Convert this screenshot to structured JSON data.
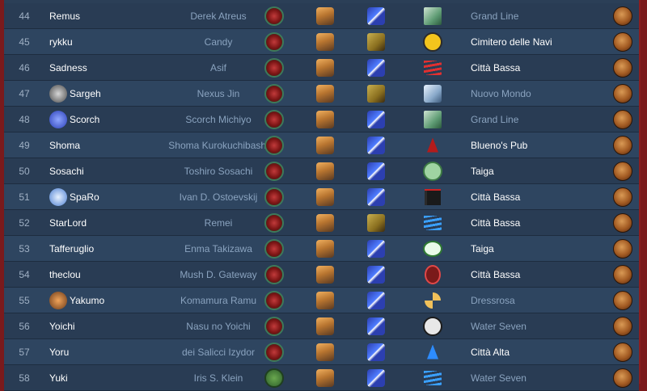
{
  "rows": [
    {
      "num": "44",
      "user": "Remus",
      "char": "Derek Atreus",
      "avatar": "",
      "icon5": "map-icon",
      "loc": "Grand Line",
      "loc_style": "blue"
    },
    {
      "num": "45",
      "user": "rykku",
      "char": "Candy",
      "avatar": "",
      "icon5": "smiley-icon",
      "loc": "Cimitero delle Navi",
      "loc_style": "white"
    },
    {
      "num": "46",
      "user": "Sadness",
      "char": "Asif",
      "avatar": "",
      "icon5": "red-wave-icon",
      "loc": "Città Bassa",
      "loc_style": "white"
    },
    {
      "num": "47",
      "user": "Sargeh",
      "char": "Nexus Jin",
      "avatar": "stone-avatar",
      "icon5": "crowd-icon",
      "loc": "Nuovo Mondo",
      "loc_style": "blue"
    },
    {
      "num": "48",
      "user": "Scorch",
      "char": "Scorch Michiyo",
      "avatar": "blue-avatar",
      "icon5": "map-icon",
      "loc": "Grand Line",
      "loc_style": "blue"
    },
    {
      "num": "49",
      "user": "Shoma",
      "char": "Shoma Kurokuchibashi",
      "avatar": "",
      "icon5": "red-drops-icon",
      "loc": "Blueno's Pub",
      "loc_style": "white"
    },
    {
      "num": "50",
      "user": "Sosachi",
      "char": "Toshiro Sosachi",
      "avatar": "",
      "icon5": "skull-green-icon",
      "loc": "Taiga",
      "loc_style": "white"
    },
    {
      "num": "51",
      "user": "SpaRo",
      "char": "Ivan D. Ostoevskij",
      "avatar": "ghost-avatar",
      "icon5": "flag-icon",
      "loc": "Città Bassa",
      "loc_style": "white"
    },
    {
      "num": "52",
      "user": "StarLord",
      "char": "Remei",
      "avatar": "",
      "icon5": "blue-wave-icon",
      "loc": "Città Bassa",
      "loc_style": "white"
    },
    {
      "num": "53",
      "user": "Tafferuglio",
      "char": "Enma Takizawa",
      "avatar": "",
      "icon5": "eye-icon",
      "loc": "Taiga",
      "loc_style": "white"
    },
    {
      "num": "54",
      "user": "theclou",
      "char": "Mush D. Gateway",
      "avatar": "",
      "icon5": "red-oval-icon",
      "loc": "Città Bassa",
      "loc_style": "white"
    },
    {
      "num": "55",
      "user": "Yakumo",
      "char": "Komamura Ramu",
      "avatar": "fox-avatar",
      "icon5": "cross-icon",
      "loc": "Dressrosa",
      "loc_style": "blue"
    },
    {
      "num": "56",
      "user": "Yoichi",
      "char": "Nasu no Yoichi",
      "avatar": "",
      "icon5": "skull-black-icon",
      "loc": "Water Seven",
      "loc_style": "blue"
    },
    {
      "num": "57",
      "user": "Yoru",
      "char": "dei Salicci Izydor",
      "avatar": "",
      "icon5": "blue-drop-icon",
      "loc": "Città Alta",
      "loc_style": "white"
    },
    {
      "num": "58",
      "user": "Yuki",
      "char": "Iris S. Klein",
      "avatar": "",
      "icon5": "blue-wave-icon",
      "loc": "Water Seven",
      "loc_style": "blue"
    }
  ],
  "colors": {
    "page_bg": "#7a1a1c",
    "row_a": "#2e4560",
    "row_b": "#293c54",
    "muted_text": "#8aa3bf",
    "white_text": "#ffffff"
  }
}
